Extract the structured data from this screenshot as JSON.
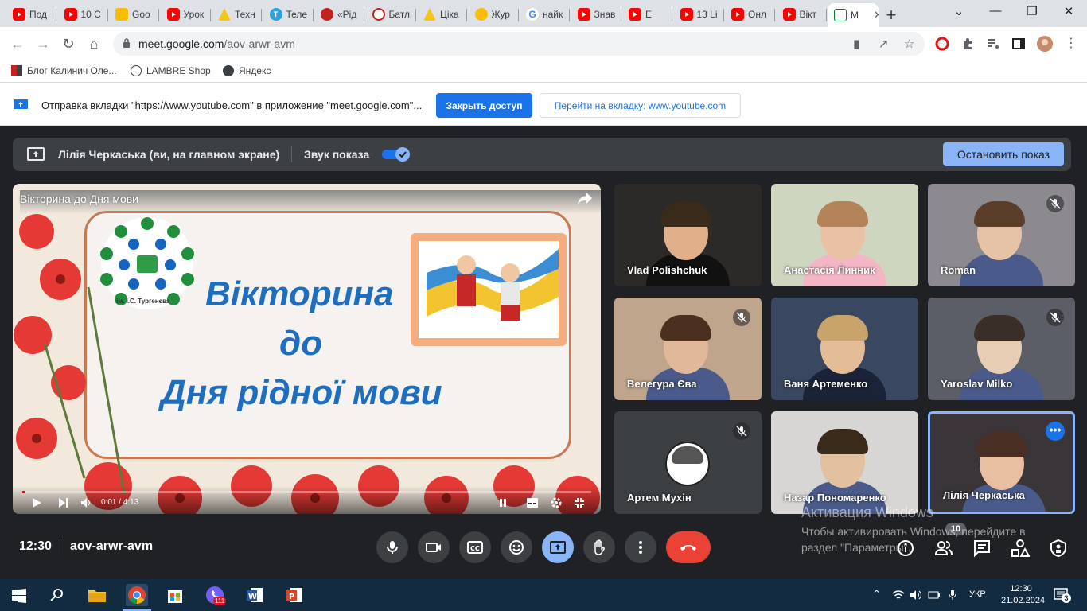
{
  "browser": {
    "tabs": [
      {
        "icon": "youtube-icon",
        "title": "Под"
      },
      {
        "icon": "youtube-icon",
        "title": "10 С"
      },
      {
        "icon": "classroom-icon",
        "title": "Goo"
      },
      {
        "icon": "youtube-icon",
        "title": "Урок"
      },
      {
        "icon": "drive-icon",
        "title": "Техн"
      },
      {
        "icon": "telegraph-icon",
        "title": "Теле"
      },
      {
        "icon": "site-icon",
        "title": "«Рід"
      },
      {
        "icon": "badge-icon",
        "title": "Батл"
      },
      {
        "icon": "drive-icon",
        "title": "Ціка"
      },
      {
        "icon": "sun-icon",
        "title": "Жур"
      },
      {
        "icon": "google-icon",
        "title": "найк"
      },
      {
        "icon": "youtube-icon",
        "title": "Знав"
      },
      {
        "icon": "youtube-icon",
        "title": "E"
      },
      {
        "icon": "youtube-icon",
        "title": "13 Li"
      },
      {
        "icon": "youtube-icon",
        "title": "Онл"
      },
      {
        "icon": "youtube-icon",
        "title": "Вікт"
      },
      {
        "icon": "meet-icon",
        "title": "M"
      }
    ],
    "url_host": "meet.google.com",
    "url_path": "/aov-arwr-avm",
    "bookmarks": [
      "Блог Калинич Оле...",
      "LAMBRE Shop",
      "Яндекс"
    ]
  },
  "sharebar": {
    "text": "Отправка вкладки \"https://www.youtube.com\" в приложение \"meet.google.com\"...",
    "close_access": "Закрыть доступ",
    "goto_tab": "Перейти на вкладку: www.youtube.com"
  },
  "presenting": {
    "name": "Лілія Черкаська (ви, на главном экране)",
    "sound_label": "Звук показа",
    "sound_on": true,
    "stop_label": "Остановить показ"
  },
  "video": {
    "title": "Вікторина до Дня мови",
    "slide_line1": "Вікторина",
    "slide_line2": "до",
    "slide_line3": "Дня рідної мови",
    "school": "ім. І.С. Тургенєва",
    "time": "0:01 / 4:13",
    "progress": 0.004
  },
  "participants": [
    {
      "name": "Vlad Polishchuk",
      "muted": false,
      "bg": "#2b2a28",
      "skin": "#e0b08a",
      "hair": "#3a2a1a"
    },
    {
      "name": "Анастасія Линник",
      "muted": false,
      "bg": "#cfd6c0",
      "skin": "#e9c2a6",
      "hair": "#b5835a"
    },
    {
      "name": "Roman",
      "muted": true,
      "bg": "#8c8a8e",
      "skin": "#e6c3a6",
      "hair": "#5a3e2a"
    },
    {
      "name": "Велегура Єва",
      "muted": true,
      "bg": "#bfa58c",
      "skin": "#e2b89a",
      "hair": "#4b3020"
    },
    {
      "name": "Ваня Артеменко",
      "muted": false,
      "bg": "#394760",
      "skin": "#e3bd98",
      "hair": "#c9a46a"
    },
    {
      "name": "Yaroslav Milko",
      "muted": true,
      "bg": "#5b5e66",
      "skin": "#e8cdb5",
      "hair": "#3a2f28"
    },
    {
      "name": "Артем Мухін",
      "muted": true,
      "bg": "#3c4043",
      "skin": "#ffffff",
      "hair": "#555555"
    },
    {
      "name": "Назар Пономаренко",
      "muted": false,
      "bg": "#d8d6d4",
      "skin": "#e3c0a0",
      "hair": "#3a2a1a"
    },
    {
      "name": "Лілія Черкаська",
      "muted": false,
      "bg": "#3a3538",
      "skin": "#e8bfa0",
      "hair": "#4a3024"
    }
  ],
  "controls": {
    "clock": "12:30",
    "meeting_code": "aov-arwr-avm",
    "people_count": "10"
  },
  "watermark": {
    "title": "Активация Windows",
    "text": "Чтобы активировать Windows, перейдите в раздел \"Параметры\"."
  },
  "taskbar": {
    "time": "12:30",
    "date": "21.02.2024",
    "lang": "УКР",
    "viber_badge": "111",
    "notifications": "3"
  },
  "colors": {
    "meet_bg": "#202124",
    "accent": "#8ab4f8",
    "hangup": "#ea4335",
    "chrome_blue": "#1a73e8",
    "taskbar": "#122b40"
  }
}
